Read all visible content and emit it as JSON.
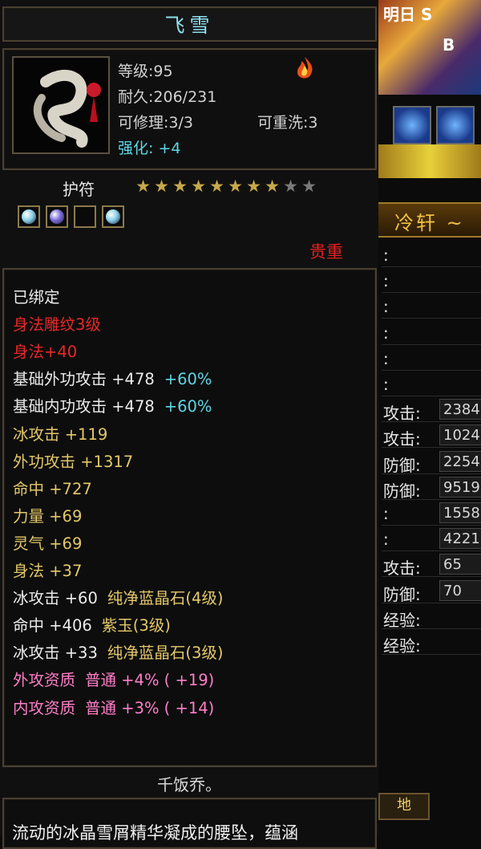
{
  "tooltip": {
    "item_name": "飞雪",
    "level_label": "等级",
    "level_value": "95",
    "durability_label": "耐久",
    "durability_value": "206/231",
    "repairable_label": "可修理",
    "repairable_value": "3/3",
    "rewashable_label": "可重洗",
    "rewashable_value": "3",
    "enhance_label": "强化",
    "enhance_value": "+4",
    "item_type": "护符",
    "stars": {
      "filled": 8,
      "total": 10
    },
    "sockets": [
      {
        "filled": true,
        "color": "#8ad0e8"
      },
      {
        "filled": true,
        "color": "#7a6ad8"
      },
      {
        "filled": false,
        "color": ""
      },
      {
        "filled": true,
        "color": "#8ad0e8"
      }
    ],
    "grade": "贵重",
    "attributes": [
      {
        "segments": [
          {
            "text": "已绑定",
            "color": "white"
          }
        ]
      },
      {
        "segments": [
          {
            "text": "身法雕纹3级",
            "color": "red"
          }
        ]
      },
      {
        "segments": [
          {
            "text": "身法+40",
            "color": "red"
          }
        ]
      },
      {
        "segments": [
          {
            "text": "基础外功攻击 +478",
            "color": "white"
          },
          {
            "text": "+60%",
            "color": "cyan"
          }
        ]
      },
      {
        "segments": [
          {
            "text": "基础内功攻击 +478",
            "color": "white"
          },
          {
            "text": "+60%",
            "color": "cyan"
          }
        ]
      },
      {
        "segments": [
          {
            "text": "冰攻击 +119",
            "color": "gold"
          }
        ]
      },
      {
        "segments": [
          {
            "text": "外功攻击 +1317",
            "color": "gold"
          }
        ]
      },
      {
        "segments": [
          {
            "text": "命中 +727",
            "color": "gold"
          }
        ]
      },
      {
        "segments": [
          {
            "text": "力量 +69",
            "color": "gold"
          }
        ]
      },
      {
        "segments": [
          {
            "text": "灵气 +69",
            "color": "gold"
          }
        ]
      },
      {
        "segments": [
          {
            "text": "身法 +37",
            "color": "gold"
          }
        ]
      },
      {
        "segments": [
          {
            "text": "冰攻击 +60",
            "color": "white"
          },
          {
            "text": "纯净蓝晶石(4级)",
            "color": "gold"
          }
        ]
      },
      {
        "segments": [
          {
            "text": "命中 +406",
            "color": "white"
          },
          {
            "text": "紫玉(3级)",
            "color": "gold"
          }
        ]
      },
      {
        "segments": [
          {
            "text": "冰攻击 +33",
            "color": "white"
          },
          {
            "text": "纯净蓝晶石(3级)",
            "color": "gold"
          }
        ]
      },
      {
        "segments": [
          {
            "text": "外攻资质",
            "color": "pink"
          },
          {
            "text": "普通 +4% ( +19)",
            "color": "pink"
          }
        ]
      },
      {
        "segments": [
          {
            "text": "内攻资质",
            "color": "pink"
          },
          {
            "text": "普通 +3% ( +14)",
            "color": "pink"
          }
        ]
      }
    ],
    "signature": "千饭乔。",
    "description": "流动的冰晶雪屑精华凝成的腰坠，蕴涵"
  },
  "right_panel": {
    "banner_text": "明日 S",
    "banner_letter": "B",
    "name_bar": "冷轩 ~",
    "rows": [
      {
        "label": ":",
        "value": ""
      },
      {
        "label": ":",
        "value": ""
      },
      {
        "label": ":",
        "value": ""
      },
      {
        "label": ":",
        "value": ""
      },
      {
        "label": ":",
        "value": ""
      },
      {
        "label": ":",
        "value": ""
      },
      {
        "label": "攻击:",
        "value": "2384"
      },
      {
        "label": "攻击:",
        "value": "1024"
      },
      {
        "label": "防御:",
        "value": "2254"
      },
      {
        "label": "防御:",
        "value": "9519"
      },
      {
        "label": ":",
        "value": "1558"
      },
      {
        "label": ":",
        "value": "4221"
      },
      {
        "label": "攻击:",
        "value": "65"
      },
      {
        "label": "防御:",
        "value": "70"
      },
      {
        "label": "经验:",
        "value": ""
      },
      {
        "label": "经验:",
        "value": ""
      }
    ],
    "bottom_button": "地"
  }
}
